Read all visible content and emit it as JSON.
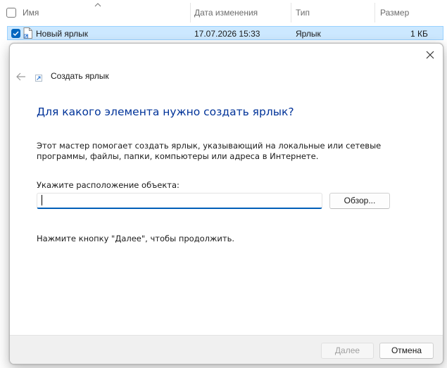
{
  "explorer": {
    "columns": {
      "name": "Имя",
      "modified": "Дата изменения",
      "type": "Тип",
      "size": "Размер"
    },
    "selected_file": {
      "name": "Новый ярлык",
      "modified": "17.07.2026 15:33",
      "type": "Ярлык",
      "size": "1 КБ"
    },
    "accent_color": "#0067c0"
  },
  "wizard": {
    "title": "Создать ярлык",
    "heading": "Для какого элемента нужно создать ярлык?",
    "description": "Этот мастер помогает создать ярлык, указывающий на локальные или сетевые программы, файлы, папки, компьютеры или адреса в Интернете.",
    "location_label": "Укажите расположение объекта:",
    "location_value": "",
    "browse_label": "Обзор...",
    "hint": "Нажмите кнопку \"Далее\", чтобы продолжить.",
    "next_label": "Далее",
    "cancel_label": "Отмена",
    "heading_color": "#003399"
  }
}
